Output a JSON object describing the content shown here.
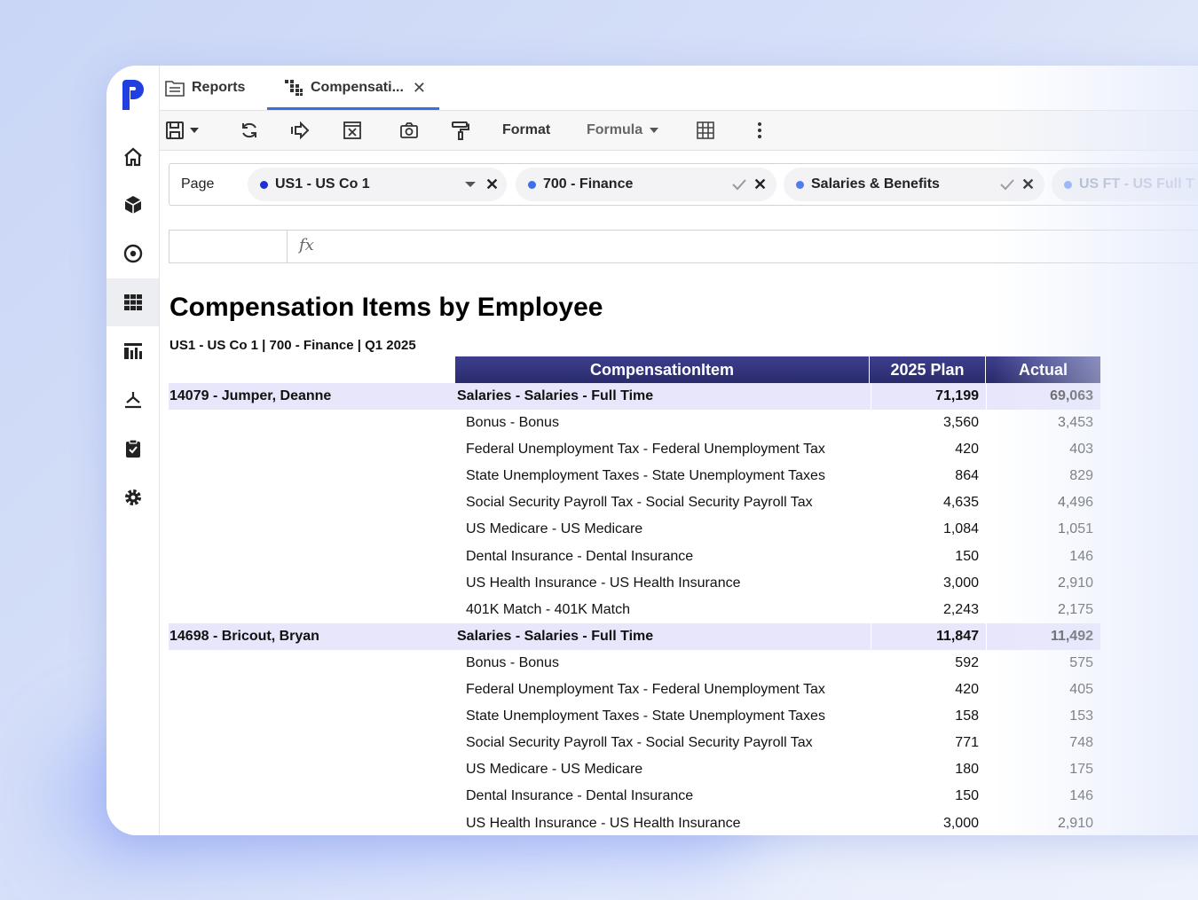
{
  "tabs": [
    {
      "label": "Reports",
      "icon": "reports-icon"
    },
    {
      "label": "Compensati...",
      "icon": "grid-report-icon",
      "close": "✕"
    }
  ],
  "toolbar": {
    "format_label": "Format",
    "formula_label": "Formula"
  },
  "page_bar": {
    "label": "Page",
    "filters": [
      {
        "label": "US1 - US Co 1",
        "dot_color": "#1f2fd6"
      },
      {
        "label": "700 - Finance",
        "dot_color": "#3f6fe8"
      },
      {
        "label": "Salaries & Benefits",
        "dot_color": "#4f7df0"
      },
      {
        "label": "US FT - US Full T",
        "dot_color": "#7f9ff5"
      }
    ]
  },
  "formula_bar": {
    "fx": "fx"
  },
  "report": {
    "title": "Compensation Items by Employee",
    "subtitle": "US1 - US Co 1  |  700 - Finance  |  Q1 2025",
    "columns": {
      "item": "CompensationItem",
      "plan": "2025 Plan",
      "actual": "Actual"
    },
    "rows": [
      {
        "employee": "14079 - Jumper, Deanne",
        "item": "Salaries - Salaries - Full Time",
        "plan": "71,199",
        "actual": "69,063",
        "group": true
      },
      {
        "employee": "",
        "item": "Bonus - Bonus",
        "plan": "3,560",
        "actual": "3,453"
      },
      {
        "employee": "",
        "item": "Federal Unemployment Tax - Federal Unemployment Tax",
        "plan": "420",
        "actual": "403"
      },
      {
        "employee": "",
        "item": "State Unemployment Taxes - State Unemployment Taxes",
        "plan": "864",
        "actual": "829"
      },
      {
        "employee": "",
        "item": "Social Security Payroll Tax - Social Security Payroll Tax",
        "plan": "4,635",
        "actual": "4,496"
      },
      {
        "employee": "",
        "item": "US Medicare - US Medicare",
        "plan": "1,084",
        "actual": "1,051"
      },
      {
        "employee": "",
        "item": "Dental Insurance - Dental Insurance",
        "plan": "150",
        "actual": "146"
      },
      {
        "employee": "",
        "item": "US Health Insurance - US Health Insurance",
        "plan": "3,000",
        "actual": "2,910"
      },
      {
        "employee": "",
        "item": "401K Match - 401K Match",
        "plan": "2,243",
        "actual": "2,175"
      },
      {
        "employee": "14698 - Bricout, Bryan",
        "item": "Salaries - Salaries - Full Time",
        "plan": "11,847",
        "actual": "11,492",
        "group": true
      },
      {
        "employee": "",
        "item": "Bonus - Bonus",
        "plan": "592",
        "actual": "575"
      },
      {
        "employee": "",
        "item": "Federal Unemployment Tax - Federal Unemployment Tax",
        "plan": "420",
        "actual": "405"
      },
      {
        "employee": "",
        "item": "State Unemployment Taxes - State Unemployment Taxes",
        "plan": "158",
        "actual": "153"
      },
      {
        "employee": "",
        "item": "Social Security Payroll Tax - Social Security Payroll Tax",
        "plan": "771",
        "actual": "748"
      },
      {
        "employee": "",
        "item": "US Medicare - US Medicare",
        "plan": "180",
        "actual": "175"
      },
      {
        "employee": "",
        "item": "Dental Insurance - Dental Insurance",
        "plan": "150",
        "actual": "146"
      },
      {
        "employee": "",
        "item": "US Health Insurance - US Health Insurance",
        "plan": "3,000",
        "actual": "2,910"
      }
    ]
  },
  "colors": {
    "brand": "#1f3fe0",
    "header_bg": "#2f3078",
    "group_row": "#e8e6fb",
    "tab_accent": "#3b6fe0"
  }
}
